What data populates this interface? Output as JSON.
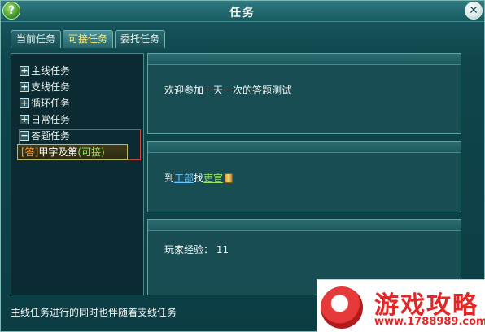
{
  "window": {
    "title": "任务",
    "help_icon_glyph": "?",
    "close_icon_glyph": "✕"
  },
  "tabs": [
    {
      "label": "当前任务",
      "active": false
    },
    {
      "label": "可接任务",
      "active": true
    },
    {
      "label": "委托任务",
      "active": false
    }
  ],
  "quest_tree": {
    "categories": [
      {
        "toggle": "+",
        "label": "主线任务"
      },
      {
        "toggle": "+",
        "label": "支线任务"
      },
      {
        "toggle": "+",
        "label": "循环任务"
      },
      {
        "toggle": "+",
        "label": "日常任务"
      },
      {
        "toggle": "−",
        "label": "答题任务"
      }
    ],
    "selected_item": {
      "tag": "[答]",
      "name": "甲字及第",
      "status": "(可接)"
    }
  },
  "details": {
    "description": "欢迎参加一天一次的答题测试",
    "target": {
      "prefix": "到",
      "place": "工部",
      "middle": "找",
      "npc": "吏官"
    },
    "reward": {
      "label": "玩家经验：",
      "value": "11"
    }
  },
  "bottom_tip": "主线任务进行的同时也伴随着支线任务",
  "watermark": {
    "title": "游戏攻略",
    "url": "www.1788989.com"
  },
  "colors": {
    "accent_tab": "#ffe97a",
    "link_place": "#69c6ff",
    "link_item": "#95e36b",
    "selection_border": "#d24343",
    "watermark": "#e22727"
  }
}
